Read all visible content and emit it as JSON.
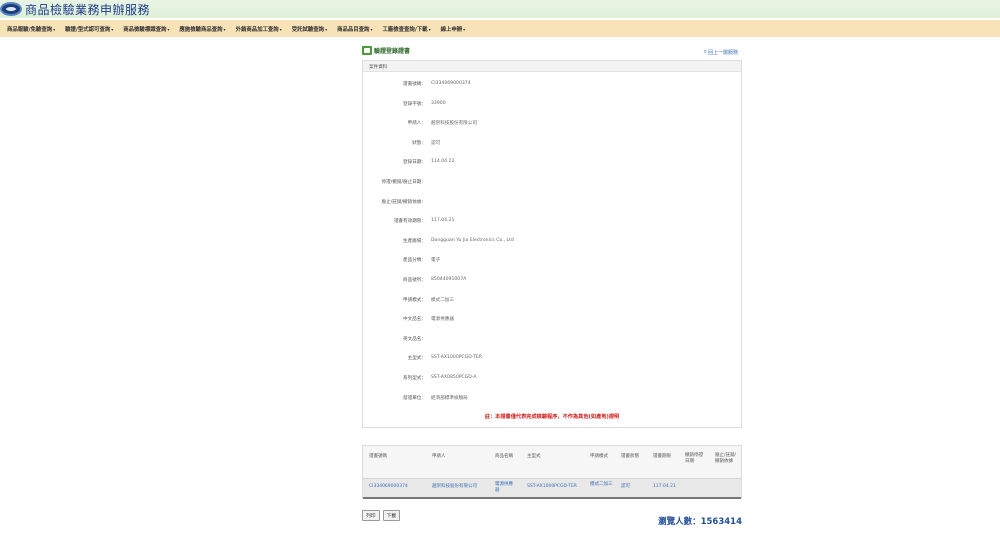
{
  "app": {
    "title": "商品檢驗業務申辦服務",
    "corner_link": ""
  },
  "nav": [
    "商品報驗/免驗查詢",
    "驗證/型式認可查詢",
    "商品檢驗標識查詢",
    "應施檢驗商品查詢",
    "外銷商品加工查詢",
    "受託試驗查詢",
    "商品品目查詢",
    "工廠檢查查詢/下載",
    "線上申辦"
  ],
  "page": {
    "title": "驗證登錄證書",
    "back_label": "回上一層服務"
  },
  "panel": {
    "header": "案件資料"
  },
  "details": [
    {
      "label": "證書號碼：",
      "value": "CI334069000374"
    },
    {
      "label": "登錄字號：",
      "value": "33900"
    },
    {
      "label": "申請人：",
      "value": "越崇科技股份有限公司"
    },
    {
      "label": "狀態：",
      "value": "認可"
    },
    {
      "label": "登錄日期：",
      "value": "114.04.22"
    },
    {
      "label": "停證/撤銷/廢止日期：",
      "value": ""
    },
    {
      "label": "廢止/註銷/撤銷依據：",
      "value": ""
    },
    {
      "label": "證書有效期限：",
      "value": "117.04.21"
    },
    {
      "label": "生產廠場：",
      "value": "Dongguan Yu Jia Electronics Co., Ltd"
    },
    {
      "label": "產品分類：",
      "value": "電子"
    },
    {
      "label": "商品號列：",
      "value": "85044091007A"
    },
    {
      "label": "申請模式：",
      "value": "模式二加三"
    },
    {
      "label": "中文品名：",
      "value": "電源供應器"
    },
    {
      "label": "英文品名：",
      "value": ""
    },
    {
      "label": "主型式：",
      "value": "SST-AX1000PCGD-TER"
    },
    {
      "label": "系列型式：",
      "value": "SST-AX0850PCGD-A"
    },
    {
      "label": "發證單位：",
      "value": "經濟部標準檢驗局"
    }
  ],
  "note": "註：本證書僅代表完成檢驗程序，不作為其他(如產地)證明",
  "table": {
    "headers": [
      "證書號碼",
      "申請人",
      "商品名稱",
      "主型式",
      "申請模式",
      "證書狀態",
      "證書期限",
      "撤銷停證日期",
      "廢止/註銷/撤銷依據"
    ],
    "rows": [
      [
        "CI334069000374",
        "越崇科技股份有限公司",
        "電源供應器",
        "SST-AX1000PCGD-TER",
        "模式二加三",
        "認可",
        "117.04.21",
        "",
        ""
      ]
    ]
  },
  "buttons": {
    "back": "列印",
    "download": "下載"
  },
  "visitors": {
    "label": "瀏覽人數：",
    "count": "1563414"
  }
}
